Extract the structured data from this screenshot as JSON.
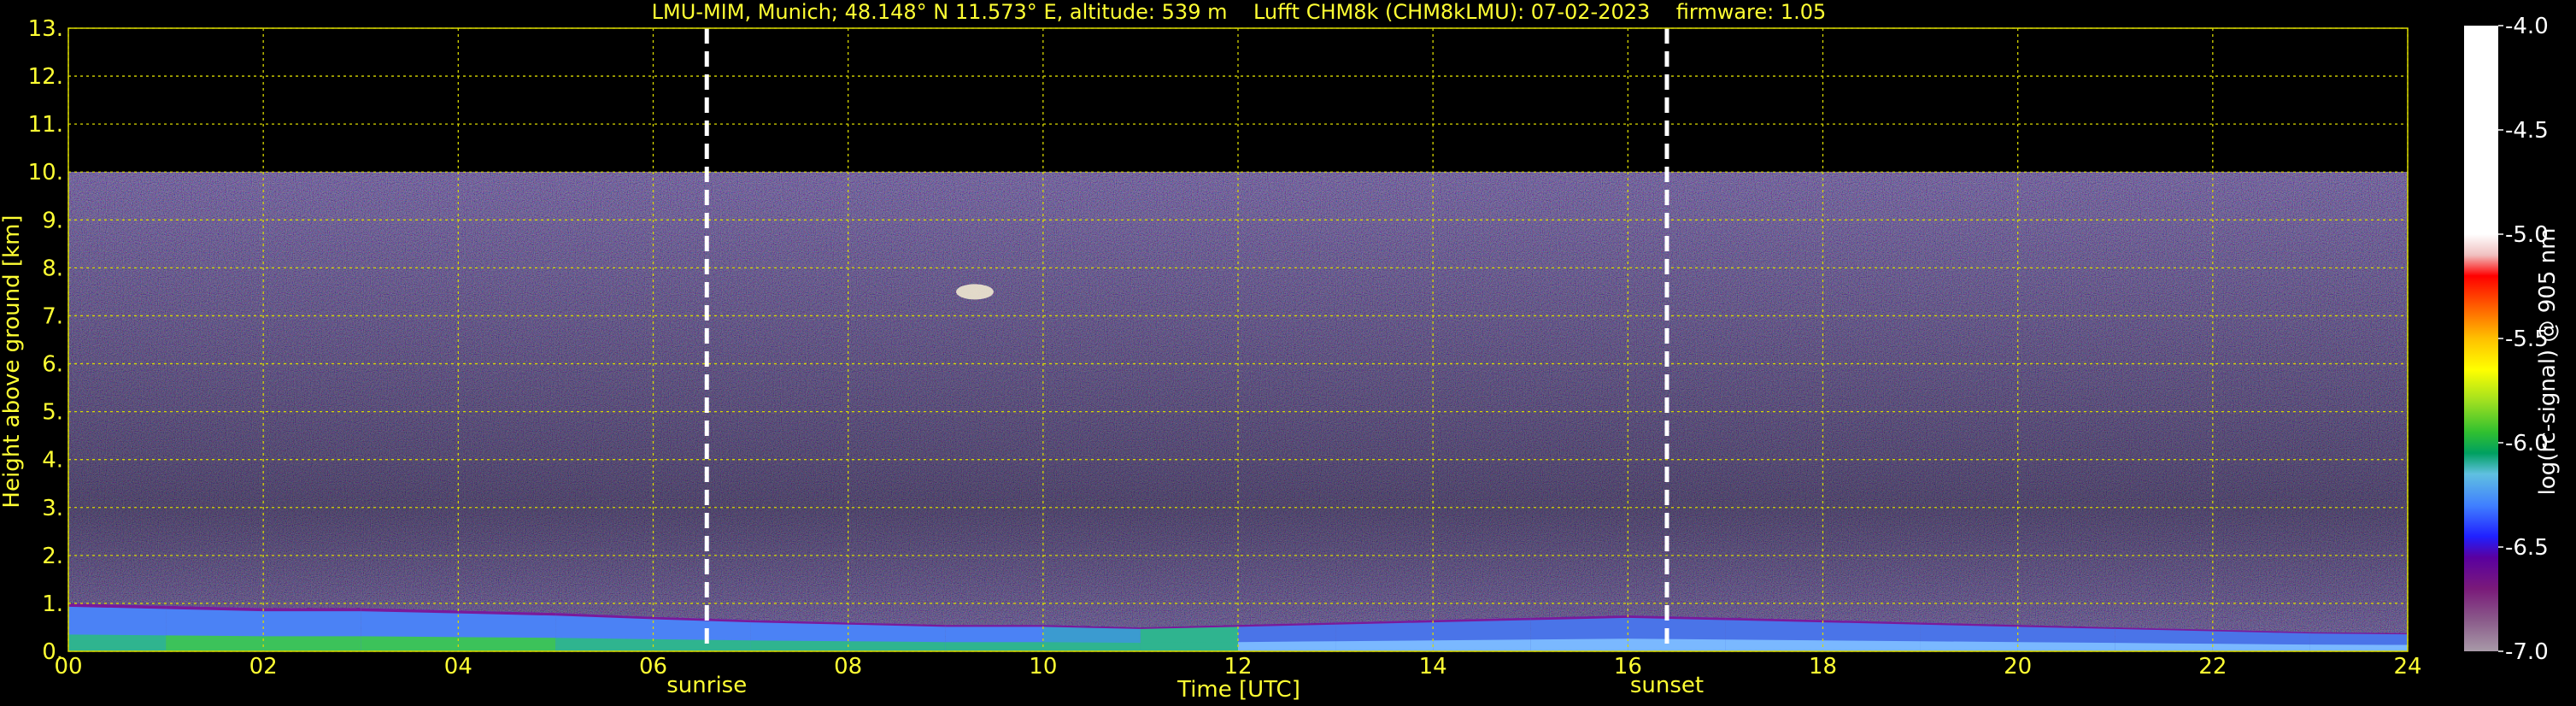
{
  "chart_data": {
    "type": "heatmap",
    "title": "LMU-MIM, Munich; 48.148° N 11.573° E, altitude: 539 m    Lufft CHM8k (CHM8kLMU): 07-02-2023    firmware: 1.05",
    "xlabel": "Time [UTC]",
    "ylabel": "Height above ground [km]",
    "xlim": [
      0,
      24
    ],
    "ylim": [
      0,
      13
    ],
    "x_ticks": [
      "00",
      "02",
      "04",
      "06",
      "08",
      "10",
      "12",
      "14",
      "16",
      "18",
      "20",
      "22",
      "24"
    ],
    "y_ticks": [
      "0.",
      "1.",
      "2.",
      "3.",
      "4.",
      "5.",
      "6.",
      "7.",
      "8.",
      "9.",
      "10.",
      "11.",
      "12.",
      "13."
    ],
    "grid": true,
    "data_top_km": 10.0,
    "markers": [
      {
        "label": "sunrise",
        "x": 6.55
      },
      {
        "label": "sunset",
        "x": 16.4
      }
    ],
    "colorbar": {
      "label": "log(rc-signal) @ 905 nm",
      "range": [
        -7.0,
        -4.0
      ],
      "ticks": [
        "-4.0",
        "-4.5",
        "-5.0",
        "-5.5",
        "-6.0",
        "-6.5",
        "-7.0"
      ],
      "tick_values": [
        -4.0,
        -4.5,
        -5.0,
        -5.5,
        -6.0,
        -6.5,
        -7.0
      ],
      "stops": [
        {
          "v": -7.0,
          "color": "#a89aa8"
        },
        {
          "v": -6.85,
          "color": "#8a5a8a"
        },
        {
          "v": -6.7,
          "color": "#7a1a7a"
        },
        {
          "v": -6.55,
          "color": "#5a00a0"
        },
        {
          "v": -6.45,
          "color": "#2020ff"
        },
        {
          "v": -6.3,
          "color": "#4080ff"
        },
        {
          "v": -6.15,
          "color": "#60c0e0"
        },
        {
          "v": -6.05,
          "color": "#00a060"
        },
        {
          "v": -5.95,
          "color": "#30c030"
        },
        {
          "v": -5.8,
          "color": "#a0e020"
        },
        {
          "v": -5.65,
          "color": "#ffff00"
        },
        {
          "v": -5.5,
          "color": "#ffc000"
        },
        {
          "v": -5.35,
          "color": "#ff6000"
        },
        {
          "v": -5.2,
          "color": "#ff0000"
        },
        {
          "v": -5.1,
          "color": "#f0c0c0"
        },
        {
          "v": -5.0,
          "color": "#ffffff"
        },
        {
          "v": -4.0,
          "color": "#ffffff"
        }
      ]
    },
    "boundary_layer": {
      "x": [
        0,
        1,
        2,
        3,
        4,
        5,
        6,
        7,
        8,
        9,
        10,
        11,
        12,
        13,
        14,
        15,
        16,
        17,
        18,
        19,
        20,
        21,
        22,
        23,
        24
      ],
      "top_km": [
        1.0,
        0.95,
        0.9,
        0.9,
        0.85,
        0.8,
        0.72,
        0.65,
        0.6,
        0.55,
        0.55,
        0.5,
        0.55,
        0.6,
        0.65,
        0.7,
        0.75,
        0.7,
        0.65,
        0.6,
        0.55,
        0.5,
        0.45,
        0.4,
        0.38
      ],
      "layer_color": [
        "#4b82f5",
        "#4b82f5",
        "#4b82f5",
        "#4b82f5",
        "#4b82f5",
        "#4b82f5",
        "#4b82f5",
        "#4b82f5",
        "#4b82f5",
        "#4b82f5",
        "#3b9bd0",
        "#2fb48f",
        "#4a74e8",
        "#4a74e8",
        "#4a74e8",
        "#4a74e8",
        "#4a74e8",
        "#4a74e8",
        "#4a74e8",
        "#4a74e8",
        "#4a74e8",
        "#4a74e8",
        "#4a74e8",
        "#4a74e8",
        "#4a74e8"
      ],
      "surface_color": [
        "#2fb48f",
        "#3cc25a",
        "#3cc25a",
        "#3cc25a",
        "#3cc25a",
        "#2fb48f",
        "#2fb48f",
        "#2fb48f",
        "#2fb48f",
        "#2fb48f",
        "#2fb48f",
        "#2fb48f",
        "#7ab8ff",
        "#7ab8ff",
        "#7ab8ff",
        "#7ab8ff",
        "#7ab8ff",
        "#7ab8ff",
        "#7ab8ff",
        "#7ab8ff",
        "#7ab8ff",
        "#7ab8ff",
        "#7ab8ff",
        "#7ab8ff",
        "#7ab8ff"
      ]
    },
    "features": [
      {
        "name": "cloud-patch",
        "x": 9.3,
        "y_km": 7.5,
        "color": "#f0e8d0"
      }
    ],
    "colors": {
      "text": "#ffff33",
      "grid": "#d8d800",
      "marker": "#ffffff",
      "noise_background": "#3a3060"
    }
  }
}
